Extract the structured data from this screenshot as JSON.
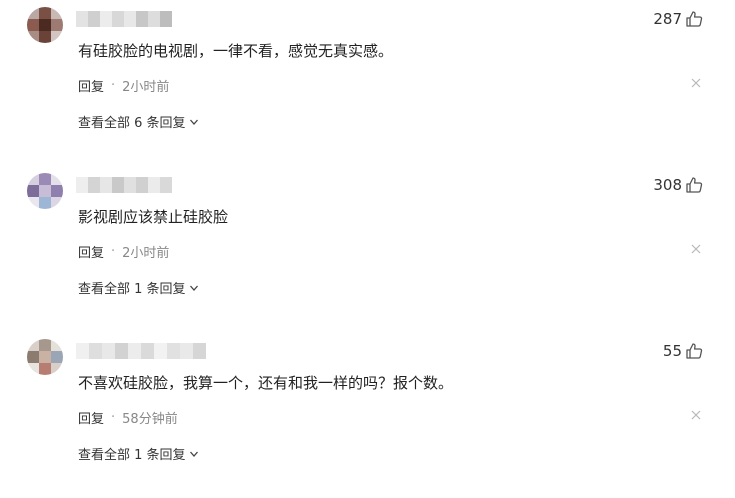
{
  "comments": [
    {
      "likes": "287",
      "text": "有硅胶脸的电视剧，一律不看，感觉无真实感。",
      "reply_label": "回复",
      "separator": "·",
      "time": "2小时前",
      "view_replies": "查看全部 6 条回复"
    },
    {
      "likes": "308",
      "text": "影视剧应该禁止硅胶脸",
      "reply_label": "回复",
      "separator": "·",
      "time": "2小时前",
      "view_replies": "查看全部 1 条回复"
    },
    {
      "likes": "55",
      "text": "不喜欢硅胶脸，我算一个，还有和我一样的吗？报个数。",
      "reply_label": "回复",
      "separator": "·",
      "time": "58分钟前",
      "view_replies": "查看全部 1 条回复"
    }
  ],
  "icons": {
    "like": "thumbs-up-icon",
    "close": "close-icon",
    "expand": "chevron-down-icon"
  },
  "colors": {
    "text": "#222222",
    "meta": "#666666",
    "icon": "#555555"
  }
}
